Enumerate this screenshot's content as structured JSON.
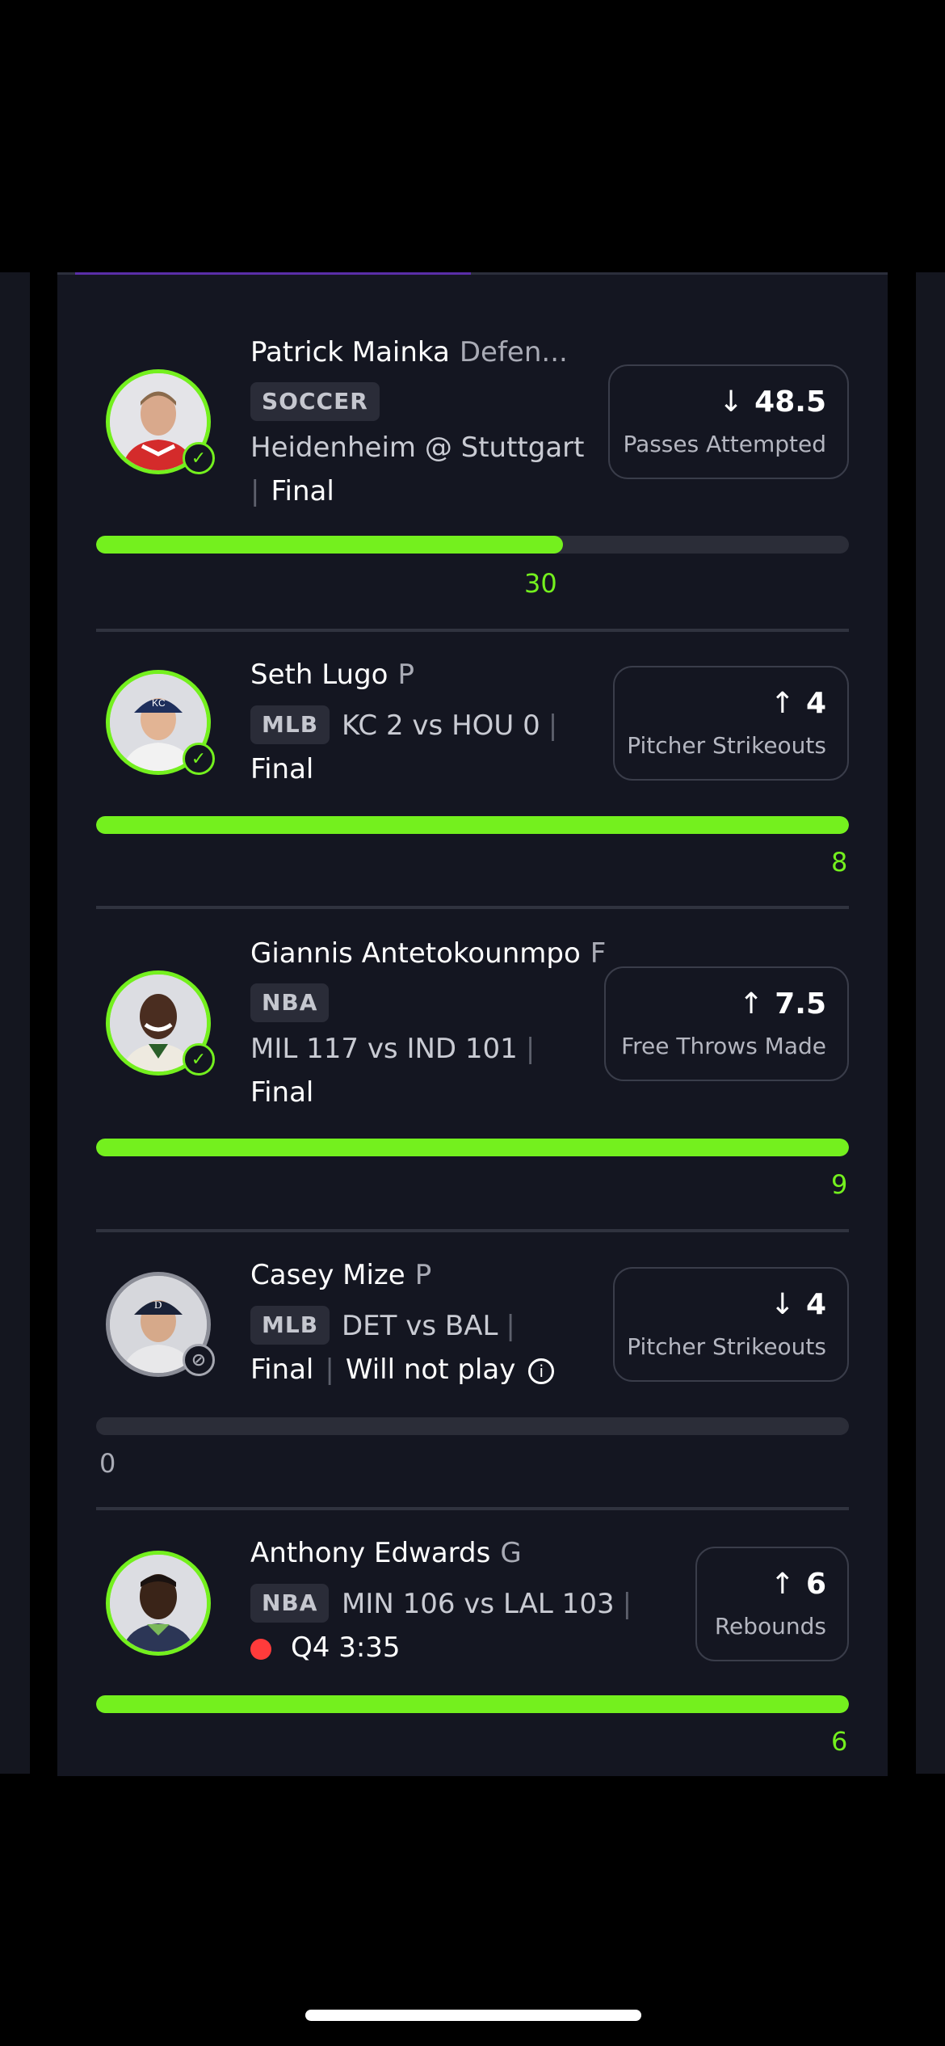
{
  "picks": [
    {
      "player": "Patrick Mainka",
      "position": "Defen...",
      "league": "SOCCER",
      "matchup": "Heidenheim @ Stuttgart",
      "status": "Final",
      "direction": "down",
      "direction_glyph": "↓",
      "line": "48.5",
      "stat": "Passes Attempted",
      "progress_value": "30",
      "progress_fraction": 0.62,
      "result": "hit"
    },
    {
      "player": "Seth Lugo",
      "position": "P",
      "league": "MLB",
      "matchup": "KC 2 vs HOU 0",
      "status": "Final",
      "direction": "up",
      "direction_glyph": "↑",
      "line": "4",
      "stat": "Pitcher Strikeouts",
      "progress_value": "8",
      "progress_fraction": 1.0,
      "result": "hit"
    },
    {
      "player": "Giannis Antetokounmpo",
      "position": "F",
      "league": "NBA",
      "matchup": "MIL 117 vs IND 101",
      "status": "Final",
      "direction": "up",
      "direction_glyph": "↑",
      "line": "7.5",
      "stat": "Free Throws Made",
      "progress_value": "9",
      "progress_fraction": 1.0,
      "result": "hit"
    },
    {
      "player": "Casey Mize",
      "position": "P",
      "league": "MLB",
      "matchup": "DET vs BAL",
      "status": "Final",
      "status_note": "Will not play",
      "direction": "down",
      "direction_glyph": "↓",
      "line": "4",
      "stat": "Pitcher Strikeouts",
      "progress_value": "0",
      "progress_fraction": 0.0,
      "result": "void"
    },
    {
      "player": "Anthony Edwards",
      "position": "G",
      "league": "NBA",
      "matchup": "MIN 106 vs LAL 103",
      "status": "Q4 3:35",
      "live": true,
      "direction": "up",
      "direction_glyph": "↑",
      "line": "6",
      "stat": "Rebounds",
      "progress_value": "6",
      "progress_fraction": 1.0,
      "result": "live"
    }
  ],
  "icons": {
    "check": "✓",
    "void": "⊘",
    "info": "i"
  },
  "colors": {
    "accent_green": "#74f01e",
    "live_red": "#ff3b3b",
    "card_bg": "#141621"
  }
}
